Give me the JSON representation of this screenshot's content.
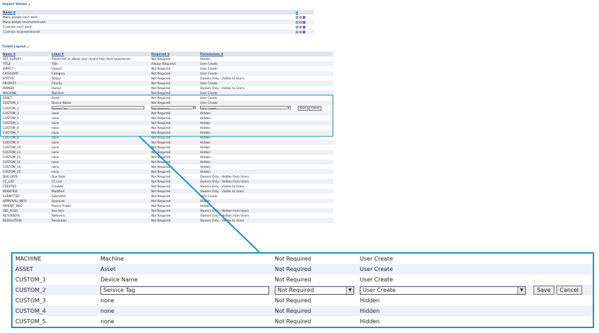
{
  "impact": {
    "title": "Impact Values",
    "header": {
      "name": "Name"
    },
    "rows": [
      "Many people can't work",
      "Many people inconvenienced",
      "1 person can't work",
      "1 person inconvenienced"
    ]
  },
  "ticket_layout": {
    "title": "Ticket Layout",
    "headers": {
      "name": "Name",
      "label": "Label",
      "required": "Required",
      "permissions": "Permissions"
    },
    "rows": [
      {
        "name": "SAT_SURVEY",
        "label": "Please tell us about your recent help desk experience...",
        "required": "Not Required",
        "permissions": "Hidden"
      },
      {
        "name": "TITLE",
        "label": "Title",
        "required": "Always Required",
        "permissions": "User Create"
      },
      {
        "name": "IMPACT",
        "label": "Impact",
        "required": "Not Required",
        "permissions": "User Create"
      },
      {
        "name": "CATEGORY",
        "label": "Category",
        "required": "Not Required",
        "permissions": "User Create"
      },
      {
        "name": "STATUS",
        "label": "Status",
        "required": "Not Required",
        "permissions": "Owners Only - Visible to Users"
      },
      {
        "name": "PRIORITY",
        "label": "Priority",
        "required": "Not Required",
        "permissions": "User Create"
      },
      {
        "name": "OWNER",
        "label": "Owner",
        "required": "Not Required",
        "permissions": "Owners Only - Visible to Users"
      },
      {
        "name": "MACHINE",
        "label": "Machine",
        "required": "Not Required",
        "permissions": "User Create"
      },
      {
        "name": "ASSET",
        "label": "Asset",
        "required": "Not Required",
        "permissions": "User Create"
      },
      {
        "name": "CUSTOM_1",
        "label": "Device Name",
        "required": "Not Required",
        "permissions": "User Create"
      },
      {
        "name": "CUSTOM_2",
        "label": "Service Tag",
        "required": "Not Required",
        "permissions": "User Create",
        "editing": true
      },
      {
        "name": "CUSTOM_3",
        "label": "none",
        "required": "Not Required",
        "permissions": "Hidden"
      },
      {
        "name": "CUSTOM_4",
        "label": "none",
        "required": "Not Required",
        "permissions": "Hidden"
      },
      {
        "name": "CUSTOM_5",
        "label": "none",
        "required": "Not Required",
        "permissions": "Hidden"
      },
      {
        "name": "CUSTOM_6",
        "label": "none",
        "required": "Not Required",
        "permissions": "Hidden"
      },
      {
        "name": "CUSTOM_7",
        "label": "none",
        "required": "Not Required",
        "permissions": "Hidden"
      },
      {
        "name": "CUSTOM_8",
        "label": "none",
        "required": "Not Required",
        "permissions": "Hidden"
      },
      {
        "name": "CUSTOM_9",
        "label": "none",
        "required": "Not Required",
        "permissions": "Hidden"
      },
      {
        "name": "CUSTOM_10",
        "label": "none",
        "required": "Not Required",
        "permissions": "Hidden"
      },
      {
        "name": "CUSTOM_11",
        "label": "none",
        "required": "Not Required",
        "permissions": "Hidden"
      },
      {
        "name": "CUSTOM_12",
        "label": "none",
        "required": "Not Required",
        "permissions": "Hidden"
      },
      {
        "name": "CUSTOM_13",
        "label": "none",
        "required": "Not Required",
        "permissions": "Hidden"
      },
      {
        "name": "CUSTOM_14",
        "label": "none",
        "required": "Not Required",
        "permissions": "Hidden"
      },
      {
        "name": "CUSTOM_15",
        "label": "none",
        "required": "Not Required",
        "permissions": "Hidden"
      },
      {
        "name": "DUE_DATE",
        "label": "Due Date",
        "required": "Not Required",
        "permissions": "Owners Only - Hidden from Users"
      },
      {
        "name": "CC_LIST",
        "label": "CC List",
        "required": "Not Required",
        "permissions": "Owners Only - Hidden from Users"
      },
      {
        "name": "CREATED",
        "label": "Created",
        "required": "Not Required",
        "permissions": "Owners Only - Visible to Users"
      },
      {
        "name": "MODIFIED",
        "label": "Modified",
        "required": "Not Required",
        "permissions": "Owners Only - Visible to Users"
      },
      {
        "name": "SUBMITTER",
        "label": "Submitter",
        "required": "Not Required",
        "permissions": "User Create"
      },
      {
        "name": "APPROVAL_INFO",
        "label": "Approver",
        "required": "Not Required",
        "permissions": "Hidden"
      },
      {
        "name": "PARENT_INFO",
        "label": "Parent Ticket",
        "required": "Not Required",
        "permissions": "Hidden"
      },
      {
        "name": "SEE_ALSO",
        "label": "See Also",
        "required": "Not Required",
        "permissions": "Owners Only - Hidden from Users"
      },
      {
        "name": "REFERRERS",
        "label": "Referrers",
        "required": "Not Required",
        "permissions": "Owners Only - Hidden from Users"
      },
      {
        "name": "RESOLUTION",
        "label": "Resolution",
        "required": "Not Required",
        "permissions": "Owners Only - Visible to Users"
      }
    ]
  },
  "zoom": {
    "rows": [
      {
        "name": "MACHINE",
        "label": "Machine",
        "required": "Not Required",
        "permissions": "User Create"
      },
      {
        "name": "ASSET",
        "label": "Asset",
        "required": "Not Required",
        "permissions": "User Create"
      },
      {
        "name": "CUSTOM_1",
        "label": "Device Name",
        "required": "Not Required",
        "permissions": "User Create"
      },
      {
        "name": "CUSTOM_2",
        "label": "Service Tag",
        "required": "Not Required",
        "permissions": "User Create",
        "editing": true
      },
      {
        "name": "CUSTOM_3",
        "label": "none",
        "required": "Not Required",
        "permissions": "Hidden"
      },
      {
        "name": "CUSTOM_4",
        "label": "none",
        "required": "Not Required",
        "permissions": "Hidden"
      },
      {
        "name": "CUSTOM_5",
        "label": "none",
        "required": "Not Required",
        "permissions": "Hidden"
      }
    ],
    "save_label": "Save",
    "cancel_label": "Cancel"
  },
  "colors": {
    "accent": "#1f93b5",
    "header_text": "#1f4f8a",
    "header_bg": "#e1e6ec"
  },
  "icons": [
    "add-icon",
    "edit-icon",
    "delete-icon",
    "reorder-icon",
    "sort-icon",
    "dropdown-arrow-icon"
  ]
}
